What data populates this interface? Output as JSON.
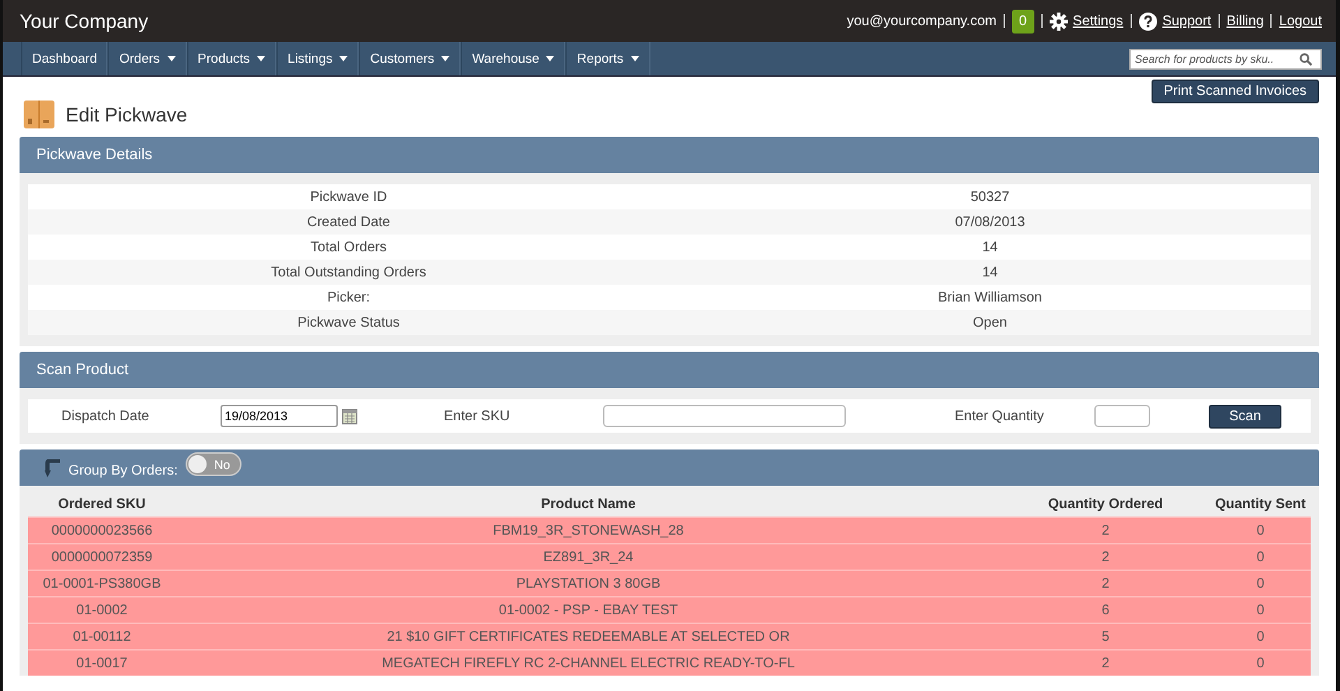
{
  "header": {
    "brand": "Your Company",
    "email": "you@yourcompany.com",
    "badge": "0",
    "links": [
      "Settings",
      "Support",
      "Billing",
      "Logout"
    ]
  },
  "nav": {
    "items": [
      {
        "label": "Dashboard",
        "dropdown": false
      },
      {
        "label": "Orders",
        "dropdown": true
      },
      {
        "label": "Products",
        "dropdown": true
      },
      {
        "label": "Listings",
        "dropdown": true
      },
      {
        "label": "Customers",
        "dropdown": true
      },
      {
        "label": "Warehouse",
        "dropdown": true
      },
      {
        "label": "Reports",
        "dropdown": true
      }
    ],
    "search": {
      "placeholder": "Search for products by sku.."
    }
  },
  "print_button": "Print Scanned Invoices",
  "page_title": "Edit Pickwave",
  "details": {
    "title": "Pickwave Details",
    "rows": [
      {
        "label": "Pickwave ID",
        "value": "50327"
      },
      {
        "label": "Created Date",
        "value": "07/08/2013"
      },
      {
        "label": "Total Orders",
        "value": "14"
      },
      {
        "label": "Total Outstanding Orders",
        "value": "14"
      },
      {
        "label": "Picker:",
        "value": "Brian Williamson"
      },
      {
        "label": "Pickwave Status",
        "value": "Open"
      }
    ]
  },
  "scan": {
    "title": "Scan Product",
    "dispatch_label": "Dispatch Date",
    "dispatch_value": "19/08/2013",
    "sku_label": "Enter SKU",
    "quantity_label": "Enter Quantity",
    "button": "Scan"
  },
  "group_by": {
    "label": "Group By Orders:",
    "toggle_text": "No",
    "on": false
  },
  "table": {
    "columns": [
      "Ordered SKU",
      "Product Name",
      "Quantity Ordered",
      "Quantity Sent"
    ],
    "rows": [
      [
        "0000000023566",
        "FBM19_3R_STONEWASH_28",
        "2",
        "0"
      ],
      [
        "0000000072359",
        "EZ891_3R_24",
        "2",
        "0"
      ],
      [
        "01-0001-PS380GB",
        "PLAYSTATION 3 80GB",
        "2",
        "0"
      ],
      [
        "01-0002",
        "01-0002 - PSP - EBAY TEST",
        "6",
        "0"
      ],
      [
        "01-00112",
        "21 $10 GIFT CERTIFICATES REDEEMABLE AT SELECTED OR",
        "5",
        "0"
      ],
      [
        "01-0017",
        "MEGATECH FIREFLY RC 2-CHANNEL ELECTRIC READY-TO-FL",
        "2",
        "0"
      ]
    ]
  }
}
